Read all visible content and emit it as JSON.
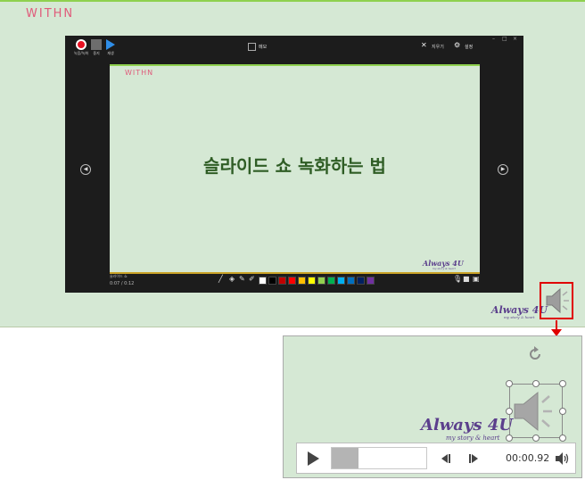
{
  "slide": {
    "logo": "WITHN",
    "brand": "Always 4U",
    "tagline": "my story & heart"
  },
  "recorder": {
    "toolbar": {
      "record_label": "녹음/녹화",
      "stop_label": "중지",
      "play_label": "재생",
      "notes_label": "메모",
      "clear_label": "지우기",
      "settings_label": "설정"
    },
    "window_controls": [
      "–",
      "□",
      "×"
    ],
    "inner_slide": {
      "logo": "WITHN",
      "title": "슬라이드 쇼 녹화하는 법",
      "brand": "Always 4U",
      "tagline": "my story & heart"
    },
    "status": {
      "slide_label": "슬라이드 쇼",
      "time": "0:07 / 0:12"
    },
    "pen_colors": [
      "#ffffff",
      "#000000",
      "#c00000",
      "#ff0000",
      "#ffc000",
      "#ffff00",
      "#92d050",
      "#00b050",
      "#00b0f0",
      "#0070c0",
      "#002060",
      "#7030a0"
    ]
  },
  "media": {
    "time": "00:00.92",
    "progress_fraction": 0.28
  },
  "colors": {
    "slide_bg": "#d5e8d4",
    "accent_green": "#8fd14f",
    "highlight_red": "#e00000",
    "brand_purple": "#5b3f8c"
  }
}
